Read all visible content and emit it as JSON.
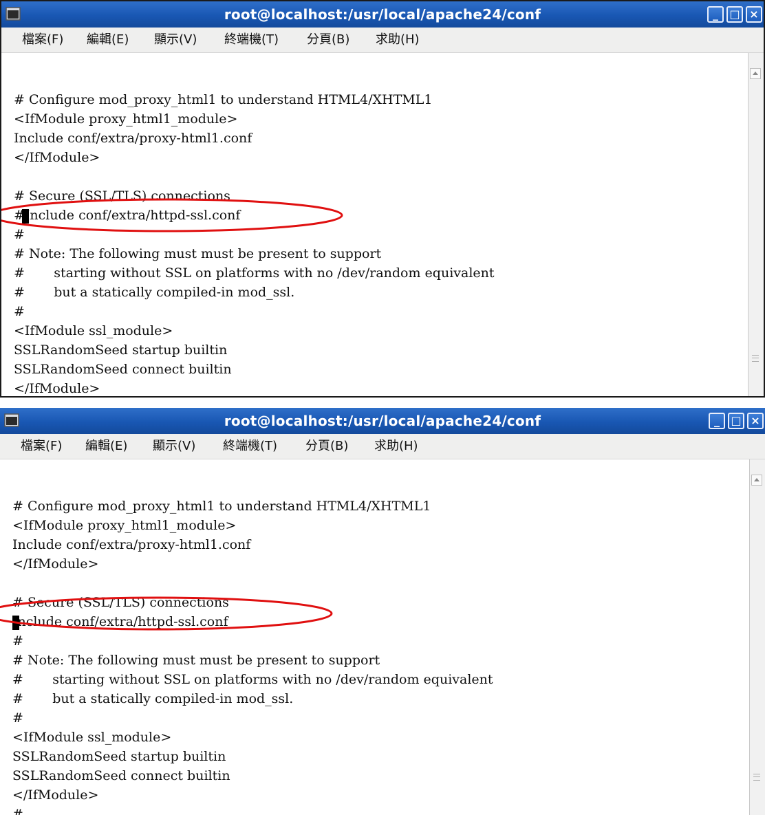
{
  "windows": [
    {
      "title": "root@localhost:/usr/local/apache24/conf",
      "menu": [
        "檔案(F)",
        "編輯(E)",
        "顯示(V)",
        "終端機(T)",
        "分頁(B)",
        "求助(H)"
      ],
      "lines": [
        "",
        "# Configure mod_proxy_html1 to understand HTML4/XHTML1",
        "<IfModule proxy_html1_module>",
        "Include conf/extra/proxy-html1.conf",
        "</IfModule>",
        "",
        "# Secure (SSL/TLS) connections",
        "#Include conf/extra/httpd-ssl.conf",
        "#",
        "# Note: The following must must be present to support",
        "#       starting without SSL on platforms with no /dev/random equivalent",
        "#       but a statically compiled-in mod_ssl.",
        "#",
        "<IfModule ssl_module>",
        "SSLRandomSeed startup builtin",
        "SSLRandomSeed connect builtin",
        "</IfModule>"
      ],
      "highlight_color": "#e01010"
    },
    {
      "title": "root@localhost:/usr/local/apache24/conf",
      "menu": [
        "檔案(F)",
        "編輯(E)",
        "顯示(V)",
        "終端機(T)",
        "分頁(B)",
        "求助(H)"
      ],
      "lines": [
        "",
        "# Configure mod_proxy_html1 to understand HTML4/XHTML1",
        "<IfModule proxy_html1_module>",
        "Include conf/extra/proxy-html1.conf",
        "</IfModule>",
        "",
        "# Secure (SSL/TLS) connections",
        "Include conf/extra/httpd-ssl.conf",
        "#",
        "# Note: The following must must be present to support",
        "#       starting without SSL on platforms with no /dev/random equivalent",
        "#       but a statically compiled-in mod_ssl.",
        "#",
        "<IfModule ssl_module>",
        "SSLRandomSeed startup builtin",
        "SSLRandomSeed connect builtin",
        "</IfModule>",
        "#"
      ],
      "highlight_color": "#e01010"
    }
  ],
  "icons": {
    "system_menu": "terminal-window-icon",
    "minimize": "minimize-icon",
    "maximize": "maximize-icon",
    "close": "close-icon",
    "scroll_up": "scroll-up-arrow-icon",
    "scroll_grip": "scroll-grip-icon"
  },
  "colors": {
    "titlebar": "#1957b3",
    "annotation": "#e01010",
    "cursor": "#000000"
  }
}
